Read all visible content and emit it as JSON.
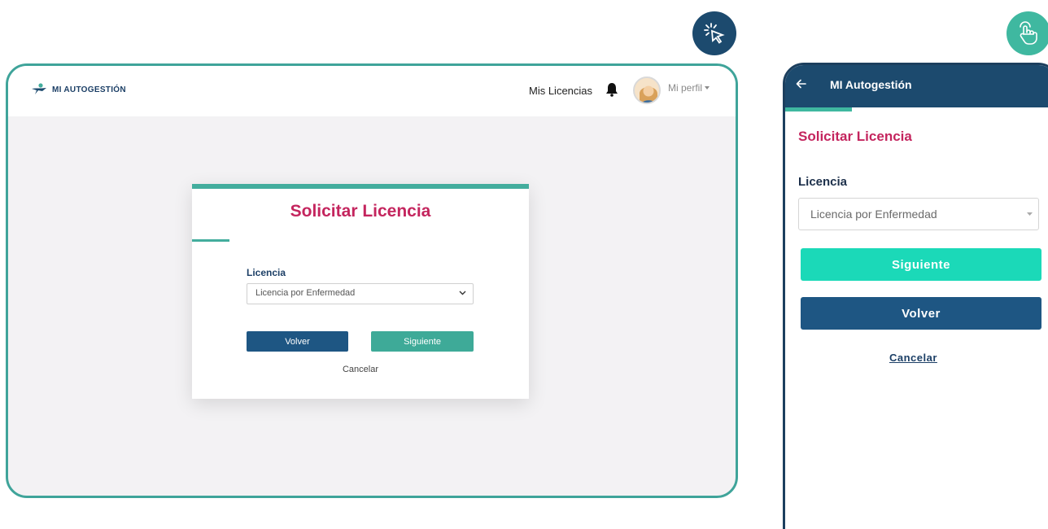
{
  "desktop": {
    "brand": "MI AUTOGESTIÓN",
    "nav_link": "Mis Licencias",
    "profile_label": "Mi perfil",
    "form": {
      "title": "Solicitar Licencia",
      "field_label": "Licencia",
      "selected_option": "Licencia por Enfermedad",
      "back_label": "Volver",
      "next_label": "Siguiente",
      "cancel_label": "Cancelar"
    }
  },
  "mobile": {
    "header_title": "MI Autogestión",
    "form": {
      "title": "Solicitar Licencia",
      "field_label": "Licencia",
      "selected_option": "Licencia por Enfermedad",
      "next_label": "Siguiente",
      "back_label": "Volver",
      "cancel_label": "Cancelar"
    }
  },
  "icons": {
    "desktop_badge": "mouse-click-icon",
    "mobile_badge": "touch-tap-icon",
    "notifications": "bell-icon",
    "avatar": "user-avatar",
    "back": "back-arrow-icon"
  },
  "colors": {
    "brand_navy": "#1c4a6e",
    "accent_teal": "#3fb8a0",
    "title_pink": "#c4255e",
    "mobile_button_teal": "#1bd9b8",
    "button_navy": "#1e5683"
  }
}
